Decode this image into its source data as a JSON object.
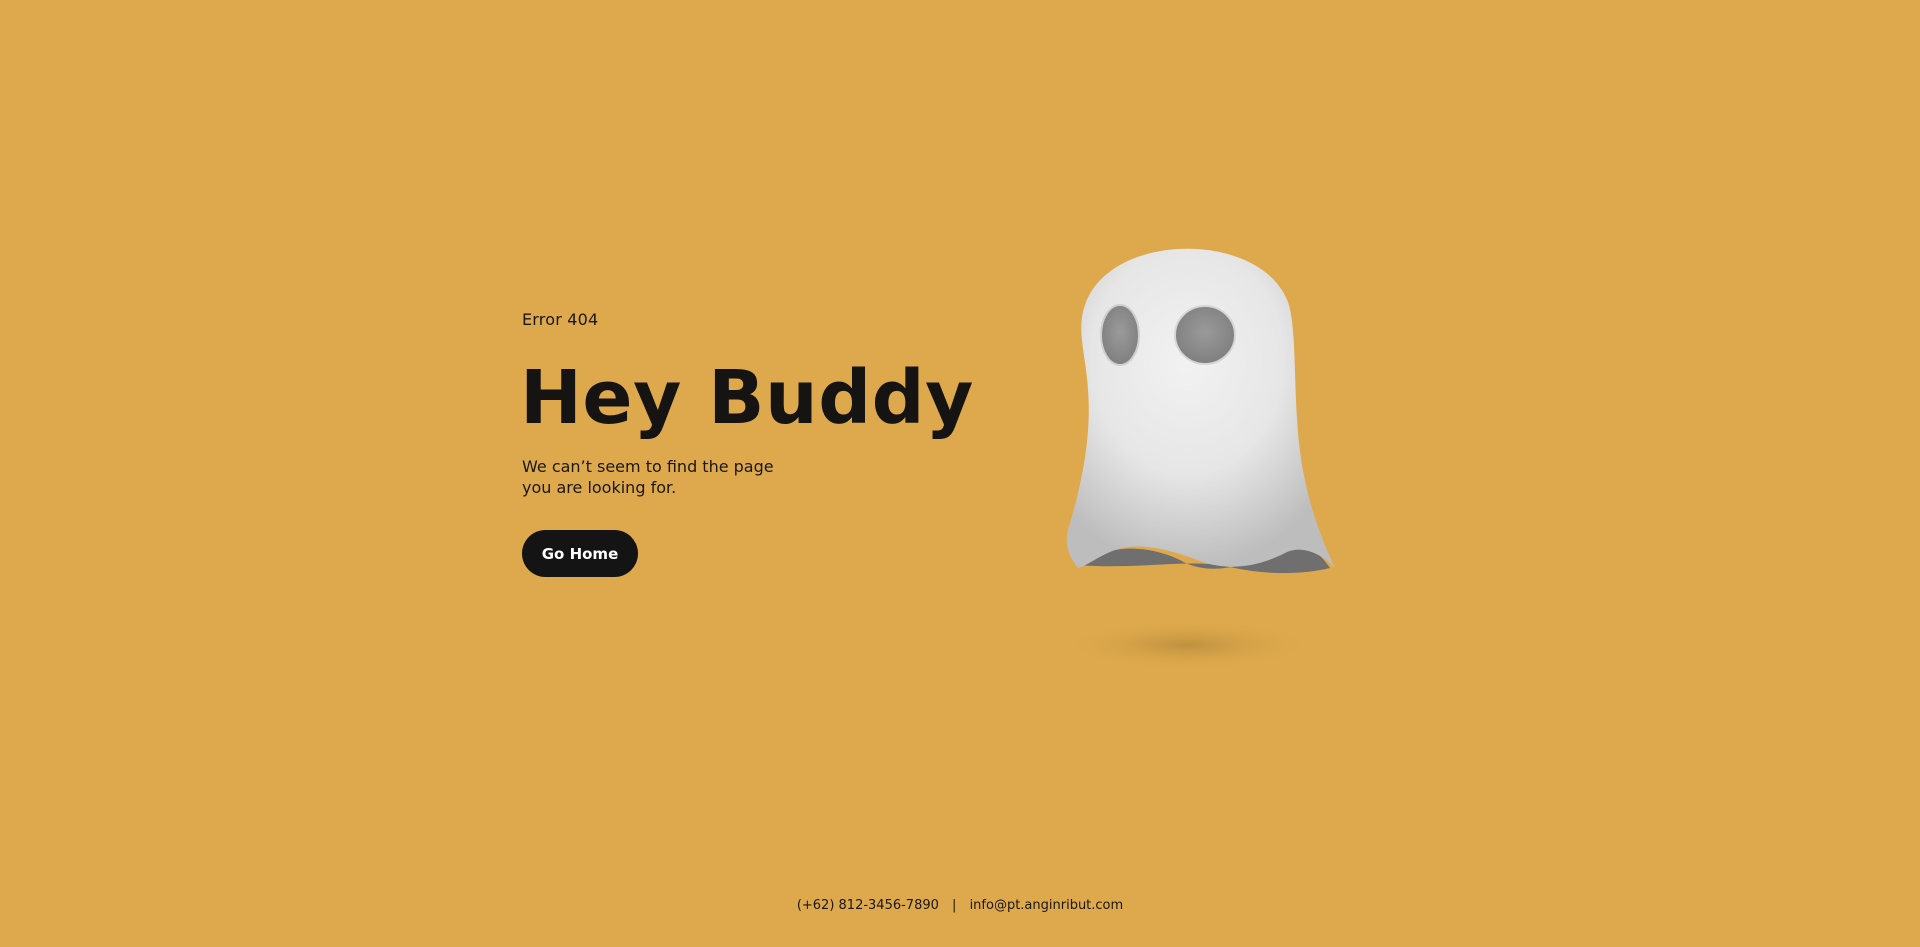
{
  "colors": {
    "background": "#dea94c",
    "text": "#161412",
    "button_background": "#141414",
    "button_text": "#ffffff",
    "ghost_body": "#e8e8e8",
    "ghost_eyes": "#8c8c8c"
  },
  "error": {
    "eyebrow": "Error 404",
    "headline": "Hey Buddy",
    "message_line1": "We can’t seem to find the page",
    "message_line2": "you are looking for."
  },
  "actions": {
    "home_label": "Go Home"
  },
  "illustration": {
    "icon": "ghost-illustration"
  },
  "footer": {
    "phone": "(+62) 812-3456-7890",
    "separator": "|",
    "email": "info@pt.anginribut.com"
  }
}
